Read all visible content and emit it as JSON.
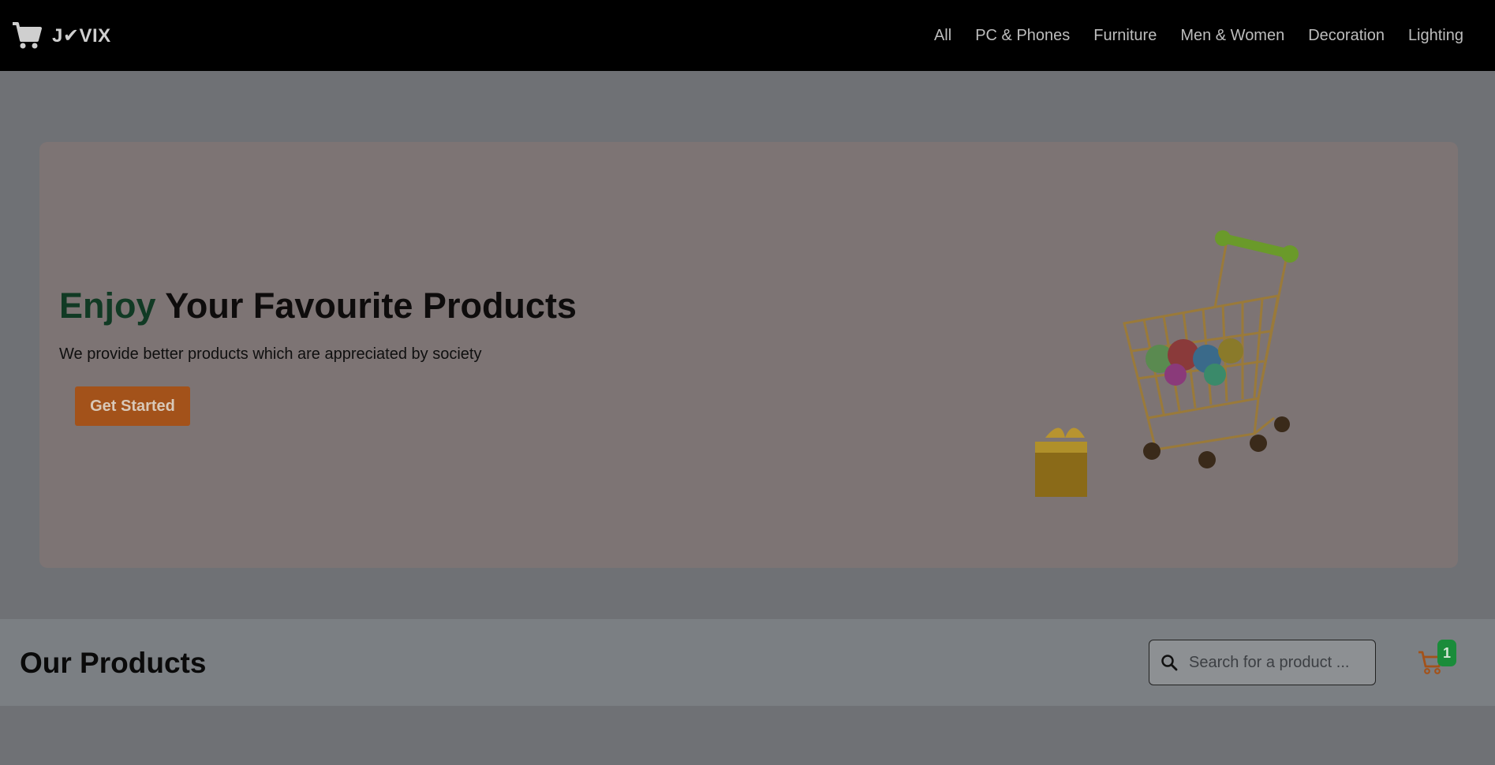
{
  "brand": {
    "name": "J✔VIX",
    "accent_color": "#000000"
  },
  "nav": {
    "items": [
      "All",
      "PC & Phones",
      "Furniture",
      "Men & Women",
      "Decoration",
      "Lighting"
    ]
  },
  "hero": {
    "title_accent": "Enjoy",
    "title_rest": " Your Favourite Products",
    "subtitle": "We provide better products which are appreciated by society",
    "cta_label": "Get Started",
    "accent_color": "#113a24",
    "cta_color": "#a3521a"
  },
  "products": {
    "title": "Our Products",
    "search_placeholder": "Search for a product ...",
    "cart_count": "1",
    "badge_color": "#1a8c3a"
  },
  "icons": {
    "header_cart": "cart-icon",
    "search": "search-icon",
    "products_cart": "cart-icon"
  }
}
